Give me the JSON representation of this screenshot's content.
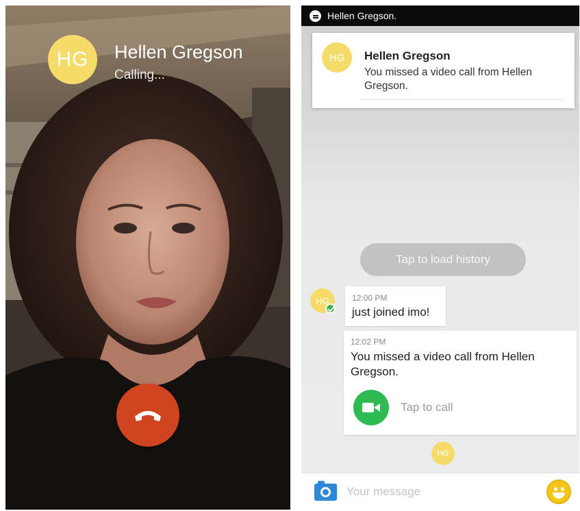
{
  "call_screen": {
    "caller_initials": "HG",
    "caller_name": "Hellen Gregson",
    "call_status": "Calling..."
  },
  "chat_screen": {
    "status_bar": {
      "icon": "chat-bubble-icon",
      "title": "Hellen Gregson."
    },
    "notification": {
      "avatar_initials": "HG",
      "title": "Hellen Gregson",
      "body": "You missed a video call from Hellen Gregson."
    },
    "load_history_label": "Tap to load history",
    "messages": [
      {
        "avatar_initials": "HG",
        "time": "12:00 PM",
        "text": "just joined imo!"
      },
      {
        "time": "12:02 PM",
        "text": "You missed a video call from Hellen Gregson.",
        "action_label": "Tap to call"
      }
    ],
    "typing_avatar_initials": "HG",
    "composer": {
      "placeholder": "Your message",
      "camera_icon": "camera-icon",
      "emoji_icon": "smiley-emoji-icon"
    }
  },
  "colors": {
    "avatar": "#f5dc6a",
    "end_call": "#d0451f",
    "video_call": "#2ebb53",
    "camera": "#2e86d6",
    "emoji": "#f7c515"
  }
}
